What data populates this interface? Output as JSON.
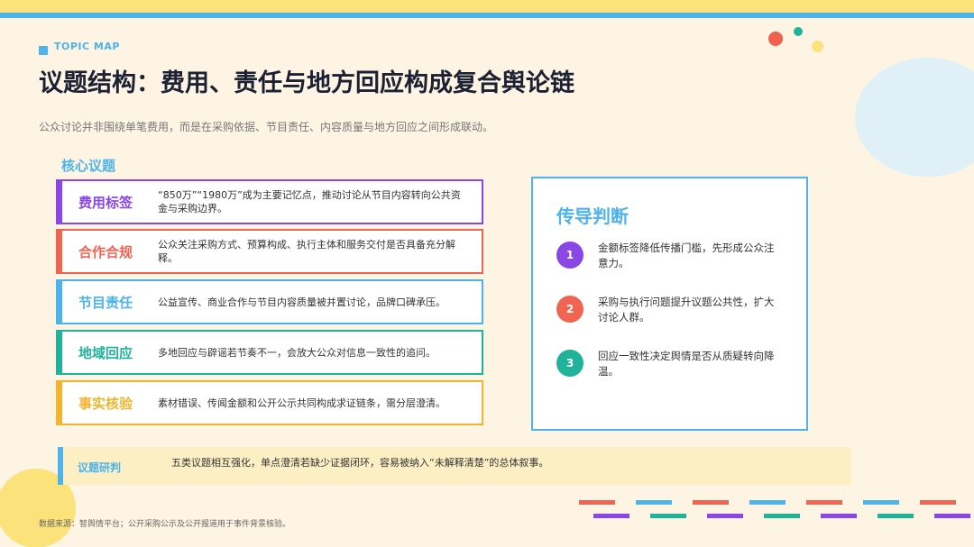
{
  "header": {
    "topic_tag": "TOPIC MAP",
    "title": "议题结构：费用、责任与地方回应构成复合舆论链",
    "subtitle": "公众讨论并非围绕单笔费用，而是在采购依据、节目责任、内容质量与地方回应之间形成联动。"
  },
  "core_issues": {
    "heading": "核心议题",
    "items": [
      {
        "label": "费用标签",
        "desc": "“850万”“1980万”成为主要记忆点，推动讨论从节目内容转向公共资金与采购边界。",
        "color": "#8b46e6"
      },
      {
        "label": "合作合规",
        "desc": "公众关注采购方式、预算构成、执行主体和服务交付是否具备充分解释。",
        "color": "#f06551"
      },
      {
        "label": "节目责任",
        "desc": "公益宣传、商业合作与节目内容质量被并置讨论，品牌口碑承压。",
        "color": "#4db3ea"
      },
      {
        "label": "地域回应",
        "desc": "多地回应与辟谣若节奏不一，会放大公众对信息一致性的追问。",
        "color": "#1fb39a"
      },
      {
        "label": "事实核验",
        "desc": "素材错误、传闻金额和公开公示共同构成求证链条，需分层澄清。",
        "color": "#f3b32d"
      }
    ]
  },
  "judgement": {
    "title": "传导判断",
    "items": [
      {
        "num": "1",
        "text": "金额标签降低传播门槛，先形成公众注意力。",
        "color": "#8b46e6"
      },
      {
        "num": "2",
        "text": "采购与执行问题提升议题公共性，扩大讨论人群。",
        "color": "#f06551"
      },
      {
        "num": "3",
        "text": "回应一致性决定舆情是否从质疑转向降温。",
        "color": "#1fb39a"
      }
    ]
  },
  "summary": {
    "label": "议题研判",
    "text": "五类议题相互强化，单点澄清若缺少证据闭环，容易被纳入“未解释清楚”的总体叙事。"
  },
  "footer": {
    "source": "数据来源：智舆情平台；公开采购公示及公开报道用于事件背景核验。"
  },
  "decor_colors": [
    "#f06551",
    "#4db3ea",
    "#8b46e6",
    "#1fb39a",
    "#fbe27a"
  ]
}
